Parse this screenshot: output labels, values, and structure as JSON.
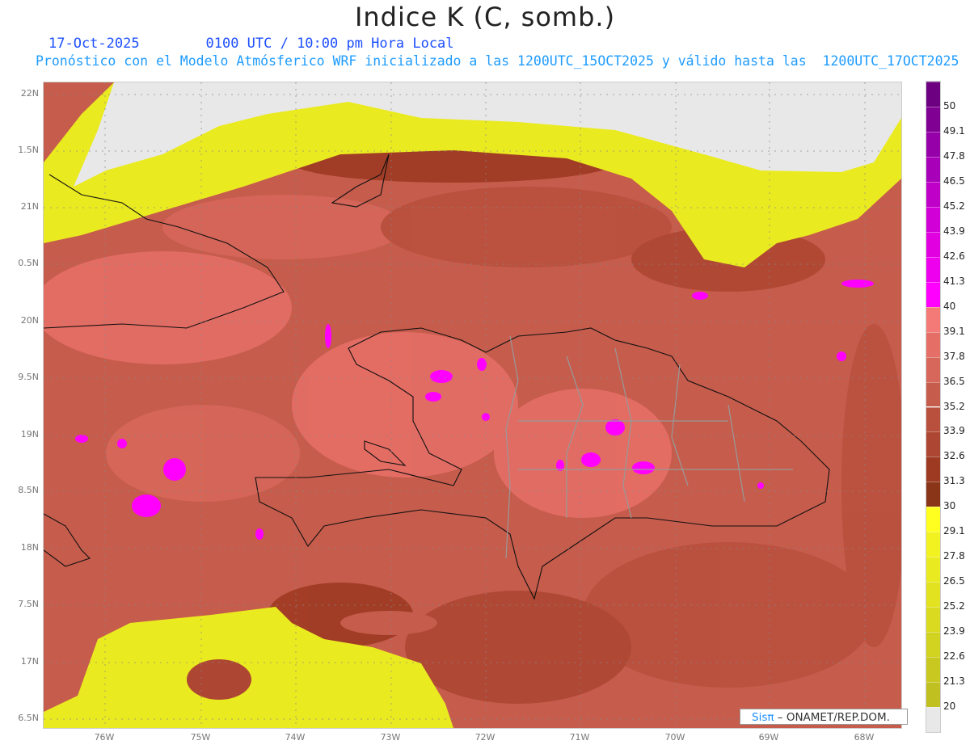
{
  "header": {
    "title": "Indice K (C, somb.)",
    "date": "17-Oct-2025",
    "time": "0100 UTC / 10:00 pm Hora Local",
    "subtitle": "Pronóstico con el Modelo Atmósferico WRF inicializado a las 1200UTC_15OCT2025 y válido hasta las  1200UTC_17OCT2025"
  },
  "axes": {
    "lat_ticks": [
      "22N",
      "1.5N",
      "21N",
      "0.5N",
      "20N",
      "9.5N",
      "19N",
      "8.5N",
      "18N",
      "7.5N",
      "17N",
      "6.5N"
    ],
    "lon_ticks": [
      "76W",
      "75W",
      "74W",
      "73W",
      "72W",
      "71W",
      "70W",
      "69W",
      "68W"
    ]
  },
  "colorbar": {
    "labels": [
      "20",
      "21.3",
      "22.6",
      "23.9",
      "25.2",
      "26.5",
      "27.8",
      "29.1",
      "30",
      "31.3",
      "32.6",
      "33.9",
      "35.2",
      "36.5",
      "37.8",
      "39.1",
      "40",
      "41.3",
      "42.6",
      "43.9",
      "45.2",
      "46.5",
      "47.8",
      "49.1",
      "50"
    ],
    "colors": [
      "#e8e8e8",
      "#c0c020",
      "#c8c820",
      "#d2d220",
      "#dada20",
      "#e2e220",
      "#eaea20",
      "#f2f220",
      "#ffff20",
      "#8b3518",
      "#9e3a22",
      "#ad4632",
      "#b9503e",
      "#c65c4c",
      "#d6675a",
      "#e56e66",
      "#f47a78",
      "#ff00ff",
      "#ee00ee",
      "#e000e0",
      "#d000d6",
      "#bf00c8",
      "#a800b8",
      "#9500a8",
      "#800094",
      "#6c0080"
    ]
  },
  "watermark": {
    "brand": "Sisπ",
    "text": " – ONAMET/REP.DOM."
  }
}
